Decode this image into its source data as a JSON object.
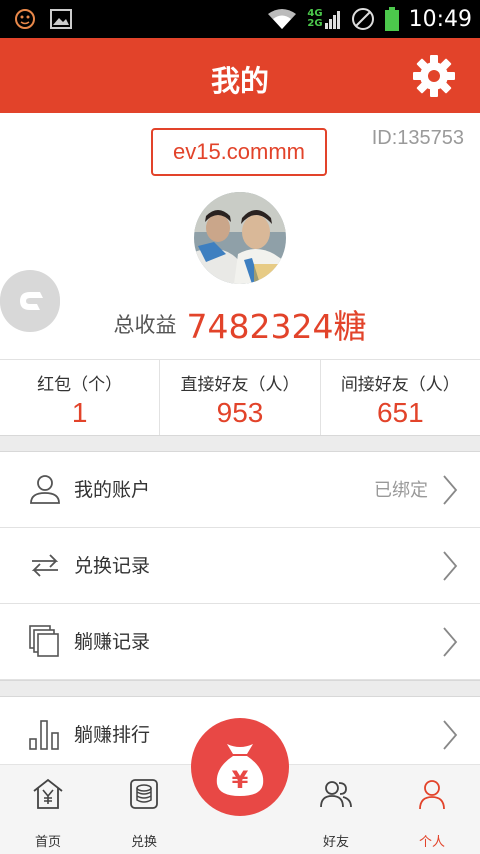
{
  "statusbar": {
    "time": "10:49",
    "network_top": "4G",
    "network_bottom": "2G"
  },
  "header": {
    "title": "我的"
  },
  "profile": {
    "code": "ev15.commm",
    "id_text": "ID:135753",
    "earnings_label": "总收益",
    "earnings_value": "7482324糖"
  },
  "stats": [
    {
      "label": "红包（个）",
      "value": "1"
    },
    {
      "label": "直接好友（人）",
      "value": "953"
    },
    {
      "label": "间接好友（人）",
      "value": "651"
    }
  ],
  "menu": {
    "account": {
      "label": "我的账户",
      "status": "已绑定",
      "icon": "user-icon"
    },
    "exchange": {
      "label": "兑换记录",
      "icon": "exchange-arrows-icon"
    },
    "records": {
      "label": "躺赚记录",
      "icon": "stacked-pages-icon"
    },
    "ranking": {
      "label": "躺赚排行",
      "icon": "bar-rank-icon"
    }
  },
  "nav": {
    "home": "首页",
    "exchange": "兑换",
    "center_symbol": "¥",
    "friends": "好友",
    "profile": "个人"
  },
  "colors": {
    "accent": "#e2432a",
    "center_button": "#e84845"
  }
}
